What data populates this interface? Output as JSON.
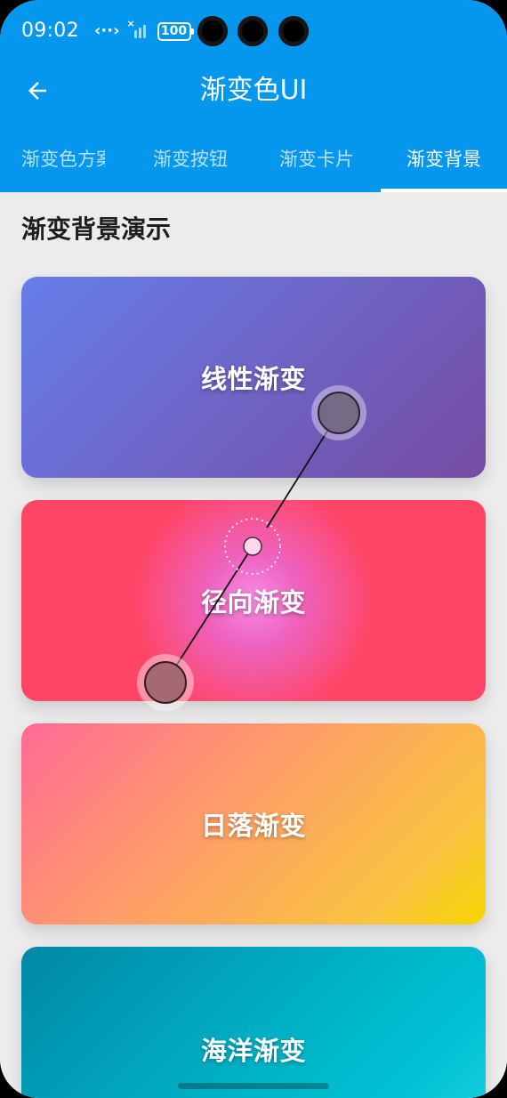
{
  "status_bar": {
    "time": "09:02",
    "network_label": "‹··›",
    "battery": "100"
  },
  "app_bar": {
    "title": "渐变色UI",
    "back_icon": "arrow-left-icon"
  },
  "tabs": [
    {
      "label": "渐变色方案",
      "active": false
    },
    {
      "label": "渐变按钮",
      "active": false
    },
    {
      "label": "渐变卡片",
      "active": false
    },
    {
      "label": "渐变背景",
      "active": true
    }
  ],
  "section_title": "渐变背景演示",
  "cards": [
    {
      "label": "线性渐变",
      "colors": [
        "#667eea",
        "#764ba2"
      ]
    },
    {
      "label": "径向渐变",
      "colors": [
        "#f78be5",
        "#ff4566"
      ]
    },
    {
      "label": "日落渐变",
      "colors": [
        "#ff6a95",
        "#f6d500"
      ]
    },
    {
      "label": "海洋渐变",
      "colors": [
        "#0089a5",
        "#20d3e2"
      ]
    }
  ],
  "colors": {
    "app_bar": "#0596ee",
    "background": "#ececec"
  }
}
